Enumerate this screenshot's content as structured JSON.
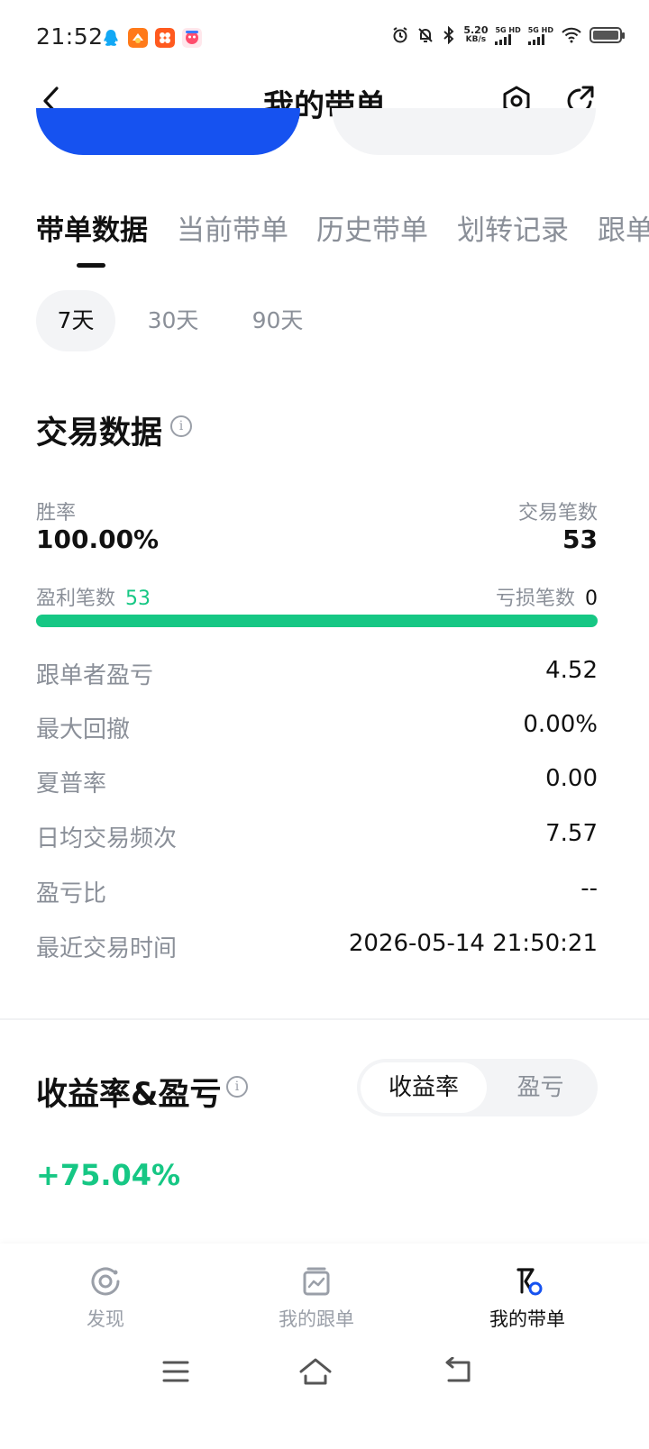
{
  "status_bar": {
    "time": "21:52",
    "network_speed_value": "5.20",
    "network_speed_unit": "KB/s",
    "sim1": "5G HD",
    "sim2": "5G HD",
    "notification_icons": [
      "qq-icon",
      "app-orange-icon",
      "app-orange-grid-icon",
      "app-mascot-icon"
    ]
  },
  "header": {
    "title": "我的带单",
    "icons": [
      "back-icon",
      "settings-hexagon-icon",
      "share-icon"
    ]
  },
  "tabs": [
    {
      "label": "带单数据",
      "active": true
    },
    {
      "label": "当前带单",
      "active": false
    },
    {
      "label": "历史带单",
      "active": false
    },
    {
      "label": "划转记录",
      "active": false
    },
    {
      "label": "跟单",
      "active": false
    }
  ],
  "periods": [
    {
      "label": "7天",
      "active": true
    },
    {
      "label": "30天",
      "active": false
    },
    {
      "label": "90天",
      "active": false
    }
  ],
  "trade_data": {
    "title": "交易数据",
    "win_rate_label": "胜率",
    "win_rate_value": "100.00%",
    "trade_count_label": "交易笔数",
    "trade_count_value": "53",
    "profit_count_label": "盈利笔数",
    "profit_count_value": "53",
    "loss_count_label": "亏损笔数",
    "loss_count_value": "0",
    "win_fraction": 1.0,
    "stats": [
      {
        "label": "跟单者盈亏",
        "value": "4.52"
      },
      {
        "label": "最大回撤",
        "value": "0.00%"
      },
      {
        "label": "夏普率",
        "value": "0.00"
      },
      {
        "label": "日均交易频次",
        "value": "7.57"
      },
      {
        "label": "盈亏比",
        "value": "--"
      },
      {
        "label": "最近交易时间",
        "value": "2026-05-14 21:50:21"
      }
    ]
  },
  "returns": {
    "title": "收益率&盈亏",
    "toggle": [
      {
        "label": "收益率",
        "active": true
      },
      {
        "label": "盈亏",
        "active": false
      }
    ],
    "value": "+75.04%"
  },
  "bottom_nav": [
    {
      "label": "发现",
      "icon": "discover-icon",
      "active": false
    },
    {
      "label": "我的跟单",
      "icon": "copy-trade-icon",
      "active": false
    },
    {
      "label": "我的带单",
      "icon": "lead-trade-icon",
      "active": true
    }
  ],
  "colors": {
    "accent_blue": "#1652f0",
    "profit_green": "#16c784",
    "text_primary": "#111111",
    "text_secondary": "#8a8f98",
    "chip_bg": "#f3f4f6"
  }
}
